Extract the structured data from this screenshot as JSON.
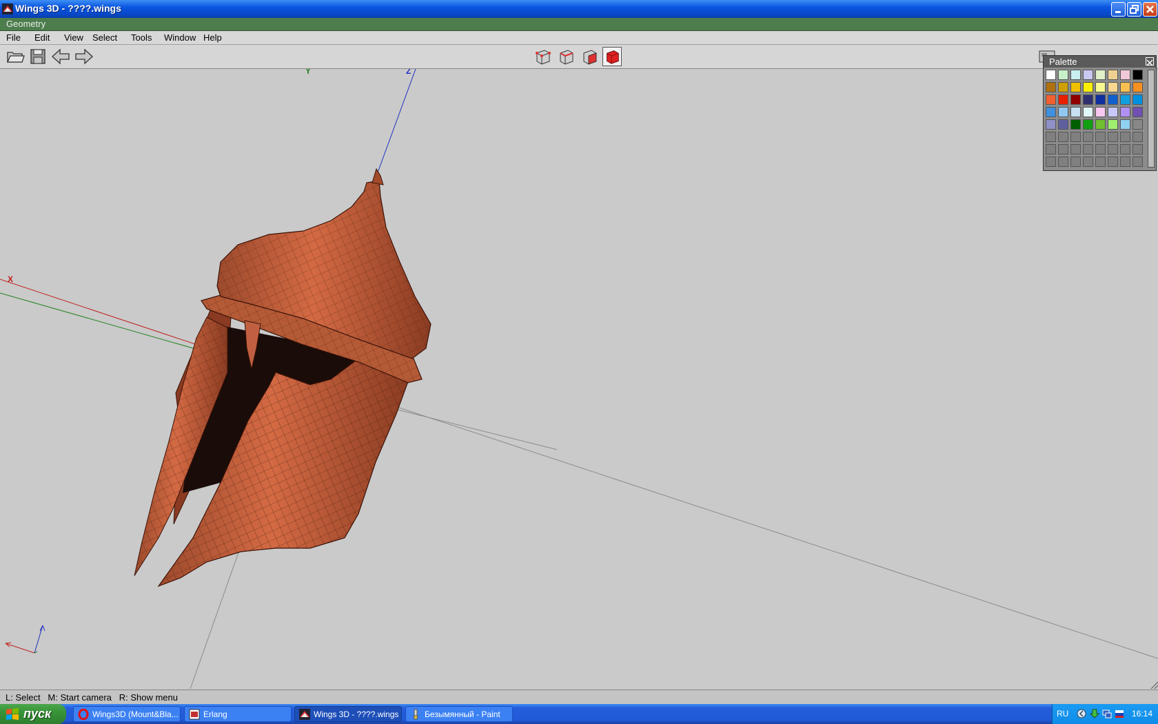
{
  "window": {
    "title": "Wings 3D - ????.wings"
  },
  "geometry_bar": {
    "label": "Geometry"
  },
  "menu": [
    "File",
    "Edit",
    "View",
    "Select",
    "Tools",
    "Window",
    "Help"
  ],
  "viewport": {
    "axis_x": "X",
    "axis_y": "Y",
    "axis_z": "Z"
  },
  "palette": {
    "title": "Palette",
    "rows": [
      [
        "#ffffff",
        "#c8f0c8",
        "#c8f0f0",
        "#c8c8f0",
        "#e0f0c8",
        "#f0d090",
        "#f0c8d8",
        "#000000"
      ],
      [
        "#b07010",
        "#d0a000",
        "#f0c000",
        "#f8f000",
        "#f8f890",
        "#f8d890",
        "#f8c050",
        "#f89020"
      ],
      [
        "#f06030",
        "#e82000",
        "#900000",
        "#303070",
        "#1030a0",
        "#1060d0",
        "#10a0e0",
        "#0090e0"
      ],
      [
        "#4090e0",
        "#90c8f0",
        "#c8e0f0",
        "#e0f8f8",
        "#f8c8f0",
        "#c8c8f8",
        "#b090f0",
        "#7050b0"
      ],
      [
        "#9090c8",
        "#6060a0",
        "#006000",
        "#10a010",
        "#70c030",
        "#a0f070",
        "#90d0f0",
        "#888888"
      ],
      [
        "#808080",
        "#808080",
        "#808080",
        "#808080",
        "#808080",
        "#808080",
        "#808080",
        "#808080"
      ],
      [
        "#808080",
        "#808080",
        "#808080",
        "#808080",
        "#808080",
        "#808080",
        "#808080",
        "#808080"
      ],
      [
        "#808080",
        "#808080",
        "#808080",
        "#808080",
        "#808080",
        "#808080",
        "#808080",
        "#808080"
      ]
    ]
  },
  "status": {
    "text": "L: Select   M: Start camera   R: Show menu"
  },
  "taskbar": {
    "start_label": "пуск",
    "tasks": [
      {
        "label": "Wings3D (Mount&Bla...",
        "icon": "opera-icon"
      },
      {
        "label": "Erlang",
        "icon": "erlang-icon"
      },
      {
        "label": "Wings 3D - ????.wings",
        "icon": "wings3d-icon",
        "active": true
      },
      {
        "label": "Безымянный - Paint",
        "icon": "paint-icon"
      }
    ],
    "lang": "RU",
    "clock": "16:14"
  }
}
